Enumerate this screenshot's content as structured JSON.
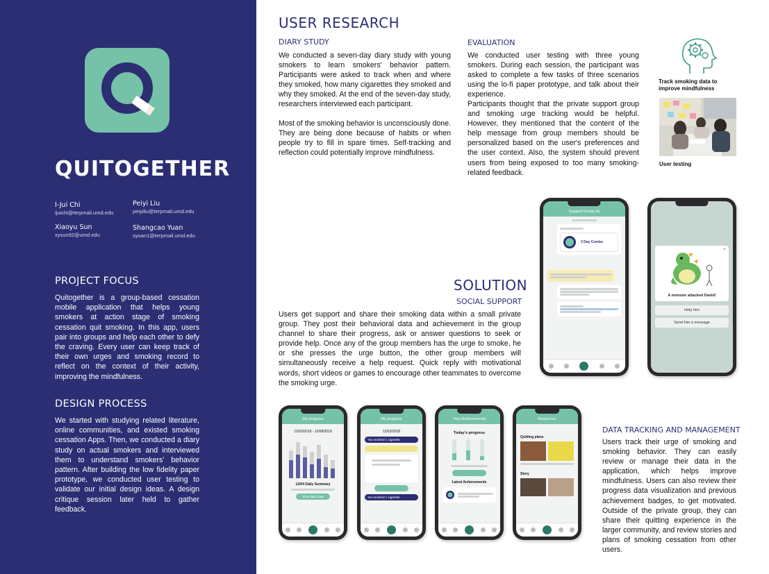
{
  "sidebar": {
    "app_title": "QUITOGETHER",
    "authors": [
      {
        "name": "I-Jui Chi",
        "email": "ijuichi@terpmail.umd.edu"
      },
      {
        "name": "Peiyi Liu",
        "email": "peiyiliu@terpmail.umd.edu"
      },
      {
        "name": "Xiaoyu Sun",
        "email": "xysun92@umd.edu"
      },
      {
        "name": "Shangcao Yuan",
        "email": "syuan1@terpmail.umd.edu"
      }
    ],
    "project_focus": {
      "heading": "PROJECT FOCUS",
      "body": "Quitogether is a group-based cessation mobile application that helps young smokers at action stage of smoking cessation quit smoking. In this app, users pair into groups and help each other to defy the craving. Every user can keep track of their own urges and smoking record to reflect on the context of their activity, improving the mindfulness."
    },
    "design_process": {
      "heading": "DESIGN PROCESS",
      "body": "We started with studying related literature, online communities, and existed smoking cessation Apps. Then, we conducted a diary study on actual smokers and interviewed them to understand smokers' behavior pattern. After building the low fidelity paper prototype, we conducted user testing to validate our initial design ideas. A design critique session later held to gather feedback."
    }
  },
  "user_research": {
    "heading": "USER RESEARCH",
    "diary": {
      "heading": "DIARY STUDY",
      "p1": "We conducted a seven-day diary study with young smokers to learn smokers' behavior pattern. Participants were asked to track when and where they smoked, how many cigarettes they smoked and why they smoked. At the end of the seven-day study, researchers interviewed each participant.",
      "p2": "Most of the smoking behavior is unconsciously done. They are being done because of habits or when people try to fill in spare times. Self-tracking and reflection could potentially improve mindfulness."
    },
    "evaluation": {
      "heading": "EVALUATION",
      "p1": "We conducted user testing with three young smokers. During each session, the participant was asked to complete a few tasks of three scenarios using the lo-fi paper prototype, and talk about their experience.",
      "p2": "Participants thought that the private support group and smoking urge tracking would be helpful. However, they mentioned that the content of the help message from group members should be personalized based on the user's preferences and the user context. Also, the system should prevent users from being exposed to too many smoking-related feedback."
    },
    "icon_caption": "Track smoking data to improve mindfulness",
    "photo_caption": "User testing"
  },
  "solution": {
    "heading": "SOLUTION",
    "social": {
      "heading": "SOCIAL SUPPORT",
      "body": "Users get support and share their smoking data within a small private group. They post their behavioral data and achievement in the group channel to share their progress, ask or answer questions to seek or provide help. Once any of the group members has the urge to smoke, he or she presses the urge button, the other group members will simultaneously receive a help request. Quick reply with motivational words, short videos or games to encourage other teammates to overcome the smoking urge."
    },
    "tracking": {
      "heading": "DATA TRACKING AND MANAGEMENT",
      "body": "Users track their urge of smoking and smoking behavior. They can easily review or manage their data in the application, which helps improve mindfulness. Users can also review their progress data visualization and previous achievement badges, to get motivated. Outside of the private group, they can share their quitting experience in the larger community, and review stories and plans of smoking cessation from other users."
    }
  },
  "phones": {
    "group_title": "Support Group (4)",
    "badge_label": "3 Day Combo",
    "monster_title": "A monster attacked David!",
    "help_btn": "Help him",
    "msg_btn": "Send him a message",
    "progress_title": "My progress",
    "date_range": "12/03/2018 - 12/08/2018",
    "daily_summary": "12/04 Daily Summary",
    "view_daily": "View daily data",
    "date_single": "12/03/2018",
    "smoked_1": "You smoked 1 cigarette",
    "achievements_title": "Your Achievements",
    "todays_progress": "Today's progress",
    "latest_ach": "Latest Achievements",
    "resources_title": "Resources",
    "quitting_plans": "Quitting plans",
    "story": "Story"
  }
}
